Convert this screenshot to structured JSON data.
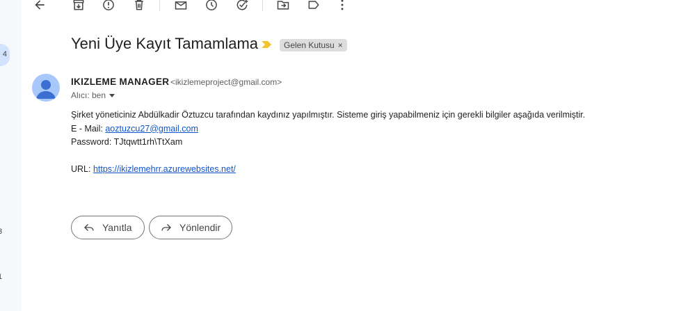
{
  "left_nav": {
    "badge": "4",
    "numbers": [
      "3",
      "1"
    ]
  },
  "toolbar": {
    "icons": [
      "back-arrow-icon",
      "archive-icon",
      "report-spam-icon",
      "delete-icon",
      "mark-unread-icon",
      "snooze-icon",
      "add-to-tasks-icon",
      "move-to-icon",
      "label-icon",
      "more-icon"
    ]
  },
  "email": {
    "subject": "Yeni Üye Kayıt Tamamlama",
    "label": "Gelen Kutusu",
    "label_remove": "×",
    "sender_name": "IKIZLEME MANAGER",
    "sender_email": "<ikizlemeproject@gmail.com>",
    "to": "Alıcı: ben",
    "body": {
      "line1": "Şirket yöneticiniz Abdülkadir Öztuzcu tarafından kaydınız yapılmıştır. Sisteme giriş yapabilmeniz için gerekli bilgiler aşağıda verilmiştir.",
      "email_label": "E - Mail: ",
      "email_link": "aoztuzcu27@gmail.com",
      "password_line": "Password: TJtqwtt1rh\\TtXam",
      "url_label": "URL: ",
      "url_link": "https://ikizlemehrr.azurewebsites.net/"
    }
  },
  "actions": {
    "reply": "Yanıtla",
    "forward": "Yönlendir"
  },
  "colors": {
    "important_marker": "#f4c430",
    "link": "#1155cc",
    "avatar_bg": "#a8c7fa",
    "avatar_fg": "#3b6fd1"
  }
}
